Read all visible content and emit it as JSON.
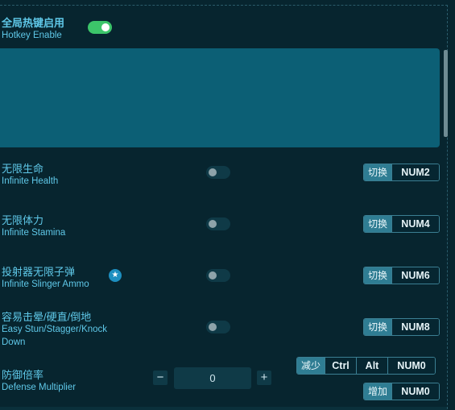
{
  "global": {
    "title_cn": "全局热键启用",
    "title_en": "Hotkey Enable",
    "enabled": true
  },
  "cheats": [
    {
      "cn": "无限生命",
      "en": "Infinite Health",
      "enabled": false,
      "action": "切换",
      "key": "NUM2"
    },
    {
      "cn": "无限体力",
      "en": "Infinite Stamina",
      "enabled": false,
      "action": "切换",
      "key": "NUM4"
    },
    {
      "cn": "投射器无限子弹",
      "en": "Infinite Slinger Ammo",
      "enabled": false,
      "action": "切换",
      "key": "NUM6",
      "star_icon": "star-icon"
    },
    {
      "cn": "容易击晕/硬直/倒地",
      "en_line1": "Easy Stun/Stagger/Knock",
      "en_line2": "Down",
      "enabled": false,
      "action": "切换",
      "key": "NUM8"
    }
  ],
  "defense": {
    "cn": "防御倍率",
    "en": "Defense Multiplier",
    "value": "0",
    "minus": "−",
    "plus": "+",
    "decrease": {
      "action": "减少",
      "keys": [
        "Ctrl",
        "Alt",
        "NUM0"
      ]
    },
    "increase": {
      "action": "增加",
      "keys": [
        "NUM0"
      ]
    }
  },
  "colors": {
    "accent": "#5fc8e8",
    "toggle_on": "#3cc56a",
    "banner": "#0c5f75",
    "background": "#07252f"
  }
}
